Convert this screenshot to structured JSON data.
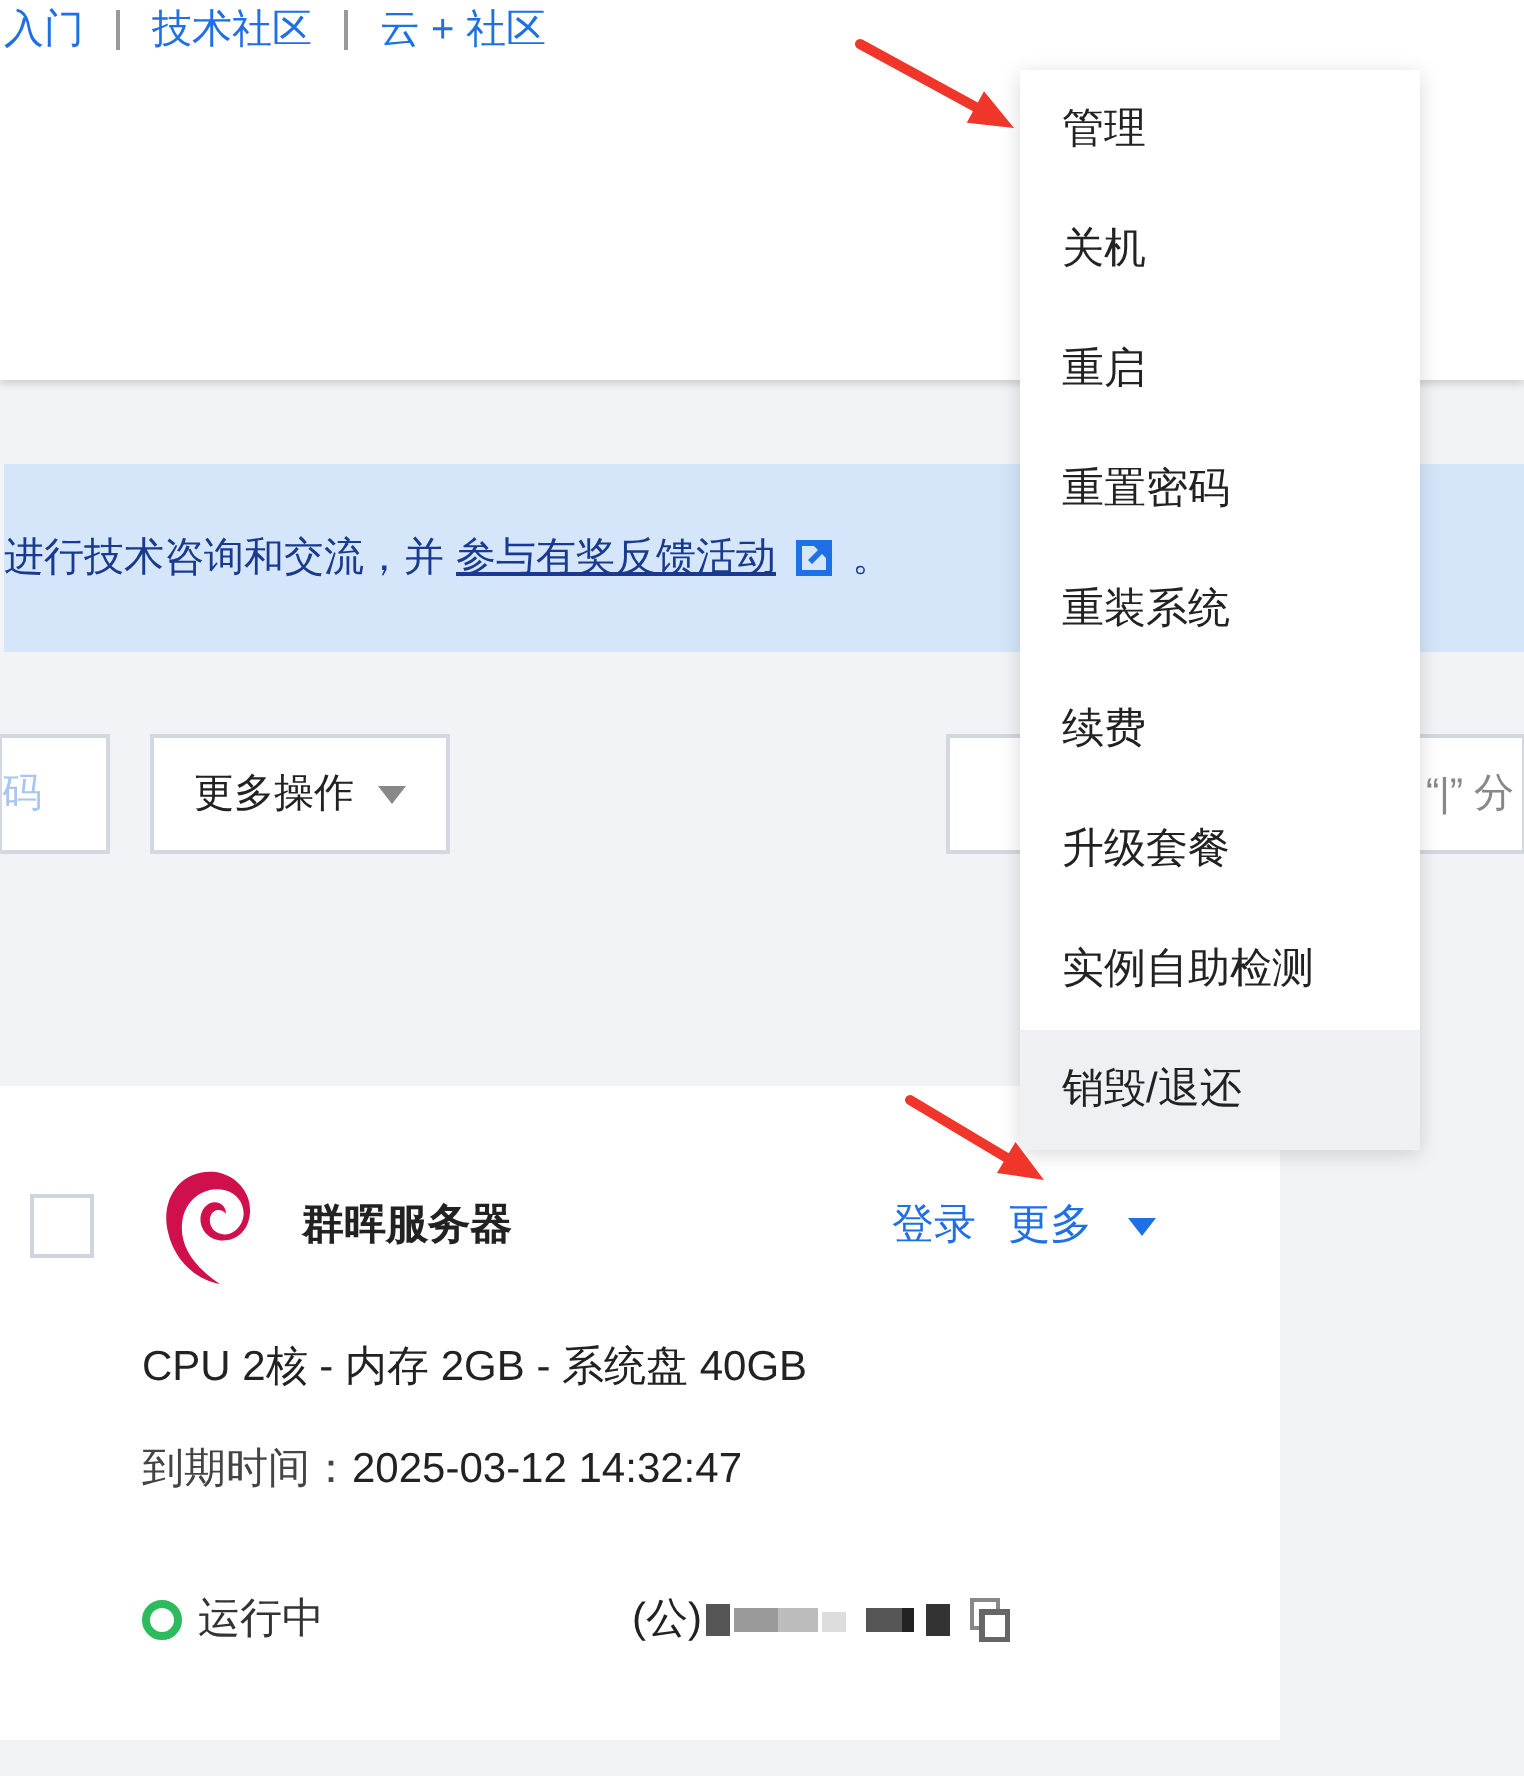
{
  "header": {
    "links": [
      "入门",
      "技术社区",
      "云 + 社区"
    ]
  },
  "banner": {
    "text": "进行技术咨询和交流，并 ",
    "link": "参与有奖反馈活动",
    "suffix": "。"
  },
  "toolbar": {
    "search": {
      "placeholder": "码"
    },
    "more_button": "更多操作",
    "filter": {
      "placeholder": "“|” 分"
    }
  },
  "instance": {
    "checked": false,
    "name": "群晖服务器",
    "actions": {
      "login": "登录",
      "more": "更多"
    },
    "specs": "CPU 2核 - 内存 2GB - 系统盘 40GB",
    "expiry_label": "到期时间：",
    "expiry": "2025-03-12 14:32:47",
    "status": "运行中",
    "address_label": "(公)"
  },
  "menu": {
    "items": [
      {
        "label": "管理",
        "highlighted": false
      },
      {
        "label": "关机",
        "highlighted": false
      },
      {
        "label": "重启",
        "highlighted": false
      },
      {
        "label": "重置密码",
        "highlighted": false
      },
      {
        "label": "重装系统",
        "highlighted": false
      },
      {
        "label": "续费",
        "highlighted": false
      },
      {
        "label": "升级套餐",
        "highlighted": false
      },
      {
        "label": "实例自助检测",
        "highlighted": false
      },
      {
        "label": "销毁/退还",
        "highlighted": true
      }
    ]
  }
}
